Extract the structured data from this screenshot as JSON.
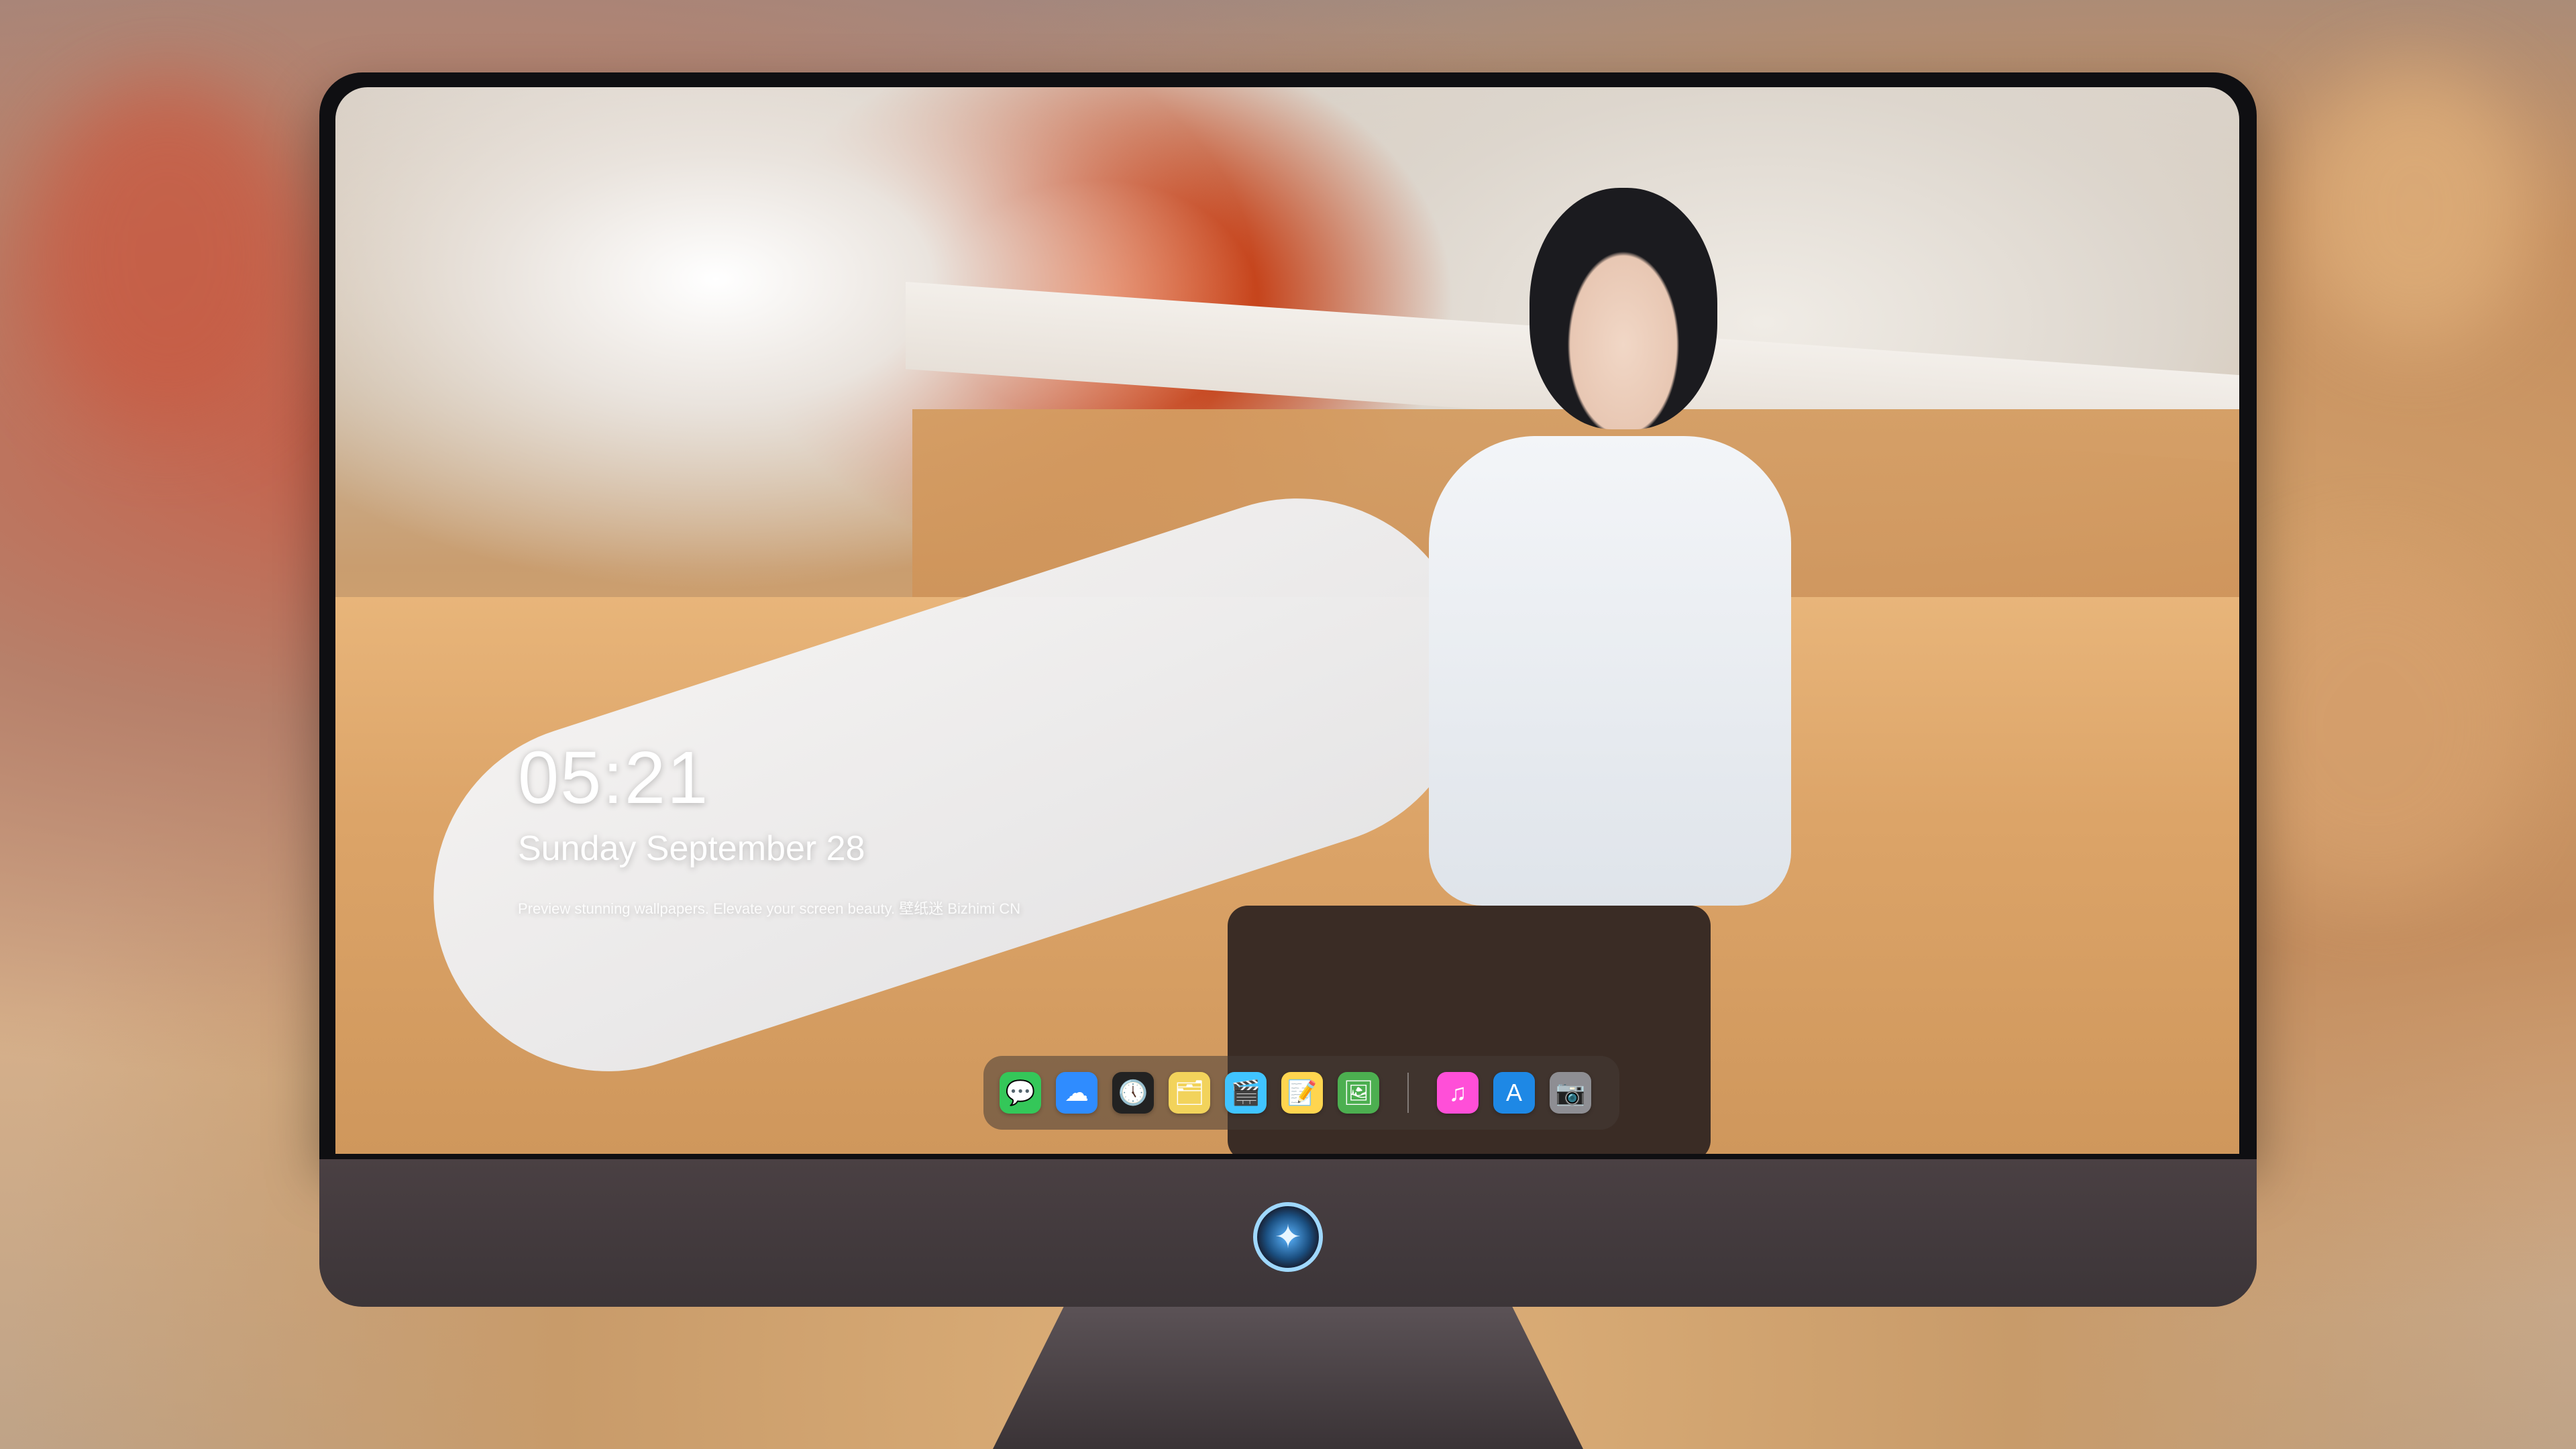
{
  "lockscreen": {
    "time": "05:21",
    "date": "Sunday September  28",
    "tagline": "Preview stunning wallpapers. Elevate your screen beauty.  壁纸迷    Bizhimi CN"
  },
  "dock": {
    "items": [
      {
        "name": "messages-icon",
        "glyph": "💬",
        "color": "#34c759"
      },
      {
        "name": "weather-icon",
        "glyph": "☁",
        "color": "#2f8cff"
      },
      {
        "name": "clock-icon",
        "glyph": "🕔",
        "color": "#222222"
      },
      {
        "name": "finder-icon",
        "glyph": "🗂",
        "color": "#f2d35b"
      },
      {
        "name": "clips-icon",
        "glyph": "🎬",
        "color": "#40c4ff"
      },
      {
        "name": "notes-icon",
        "glyph": "📝",
        "color": "#ffd54f"
      },
      {
        "name": "photos-icon",
        "glyph": "🖼",
        "color": "#4caf50"
      },
      {
        "name": "music-icon",
        "glyph": "♫",
        "color": "#ff4fd8"
      },
      {
        "name": "app-store-icon",
        "glyph": "A",
        "color": "#1e88e5"
      },
      {
        "name": "camera-icon",
        "glyph": "📷",
        "color": "#8e8e93"
      }
    ]
  },
  "branding": {
    "logo_icon": "character-badge-icon"
  }
}
